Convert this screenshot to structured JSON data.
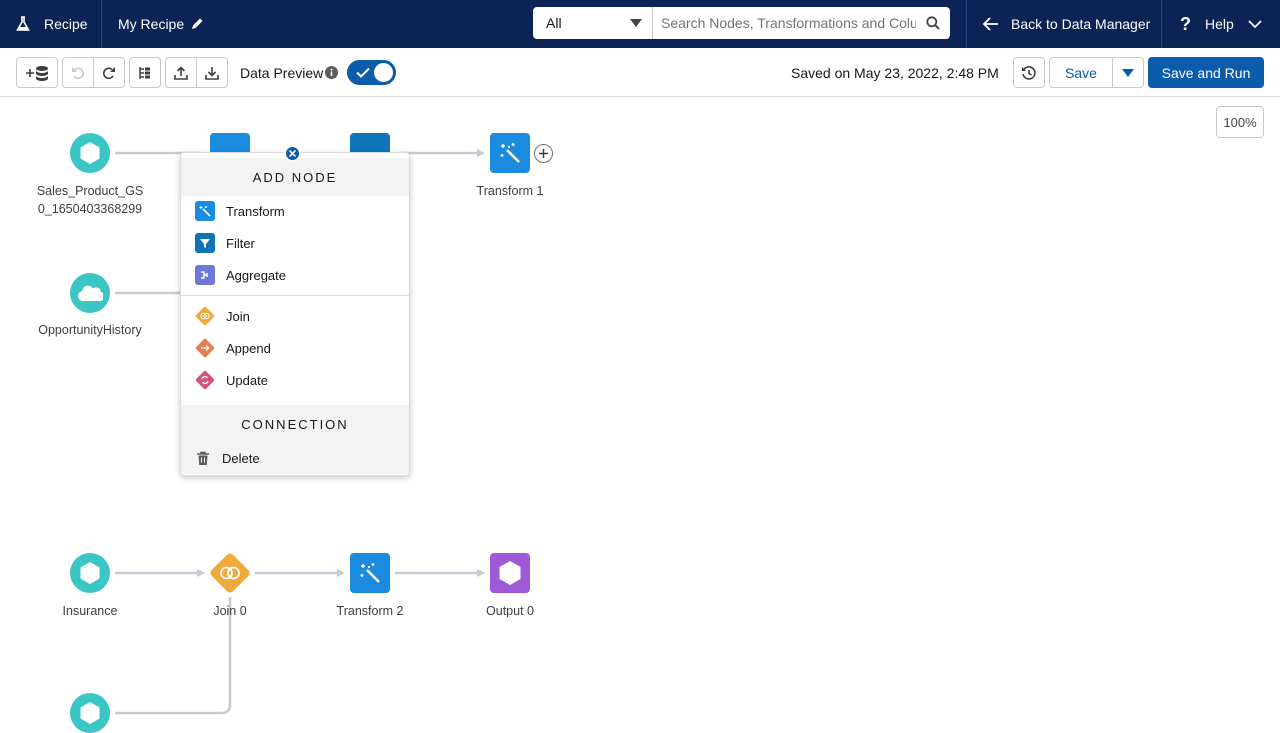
{
  "topbar": {
    "app_name": "Recipe",
    "recipe_name": "My Recipe",
    "search_scope": "All",
    "search_placeholder": "Search Nodes, Transformations and Columns",
    "back_label": "Back to Data Manager",
    "help_label": "Help",
    "help_icon": "?"
  },
  "toolbar": {
    "data_preview_label": "Data Preview",
    "data_preview_on": true,
    "saved_text": "Saved on May 23, 2022, 2:48 PM",
    "save_label": "Save",
    "save_and_run_label": "Save and Run"
  },
  "canvas": {
    "zoom": "100%",
    "nodes": {
      "sales_label": "Sales_Product_GS\n0_1650403368299",
      "opportunity_label": "OpportunityHistory",
      "transform1_label": "Transform 1",
      "insurance_label": "Insurance",
      "join0_label": "Join 0",
      "transform2_label": "Transform 2",
      "output0_label": "Output 0"
    }
  },
  "popover": {
    "add_node_title": "ADD NODE",
    "items": {
      "transform": "Transform",
      "filter": "Filter",
      "aggregate": "Aggregate",
      "join": "Join",
      "append": "Append",
      "update": "Update"
    },
    "connection_title": "CONNECTION",
    "delete_label": "Delete"
  },
  "colors": {
    "topbar_bg": "#0b2455",
    "brand_blue": "#0b5cab",
    "input_teal": "#3bc5c5",
    "transform_blue": "#1b8be0",
    "filter_blue": "#0f74b9",
    "join_orange": "#f0a93b",
    "output_purple": "#9c5ad6"
  }
}
